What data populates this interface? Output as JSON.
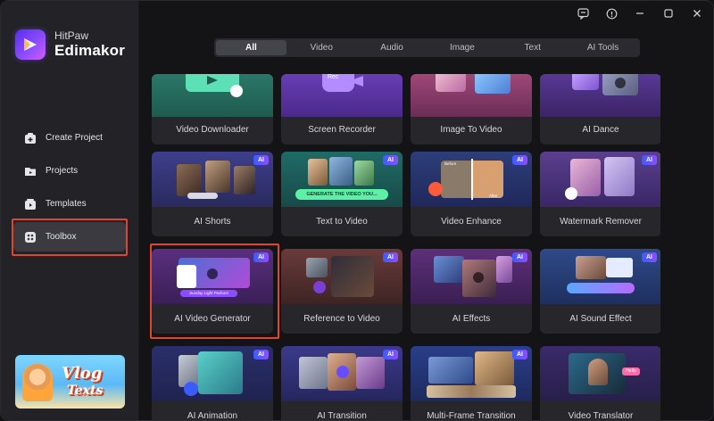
{
  "brand": {
    "line1": "HitPaw",
    "line2": "Edimakor"
  },
  "nav": [
    {
      "label": "Create Project",
      "icon": "create-project-icon"
    },
    {
      "label": "Projects",
      "icon": "projects-icon"
    },
    {
      "label": "Templates",
      "icon": "templates-icon"
    },
    {
      "label": "Toolbox",
      "icon": "toolbox-icon",
      "active": true
    }
  ],
  "promo": {
    "line1": "Vlog",
    "line2": "Texts"
  },
  "tabs": [
    "All",
    "Video",
    "Audio",
    "Image",
    "Text",
    "AI Tools"
  ],
  "active_tab": "All",
  "badge": "AI",
  "tools": [
    {
      "label": "Video Downloader",
      "ai": false
    },
    {
      "label": "Screen Recorder",
      "ai": false,
      "thumb_text": "Rec"
    },
    {
      "label": "Image To Video",
      "ai": false
    },
    {
      "label": "AI Dance",
      "ai": false
    },
    {
      "label": "AI Shorts",
      "ai": true
    },
    {
      "label": "Text to Video",
      "ai": true,
      "thumb_text": "GENERATE THE VIDEO YOU..."
    },
    {
      "label": "Video Enhance",
      "ai": true,
      "thumb_text_a": "Before",
      "thumb_text_b": "After"
    },
    {
      "label": "Watermark Remover",
      "ai": true
    },
    {
      "label": "AI Video Generator",
      "ai": true,
      "thumb_text": "Sunday Light Podcast",
      "selected": true
    },
    {
      "label": "Reference to Video",
      "ai": true
    },
    {
      "label": "AI Effects",
      "ai": true
    },
    {
      "label": "AI Sound Effect",
      "ai": true
    },
    {
      "label": "AI Animation",
      "ai": true
    },
    {
      "label": "AI Transition",
      "ai": true
    },
    {
      "label": "Multi-Frame Transition",
      "ai": true
    },
    {
      "label": "Video Translator",
      "ai": true,
      "thumb_text": "Hello"
    }
  ],
  "colors": {
    "accent_red": "#e0462e",
    "ai_badge_start": "#3a5cff",
    "ai_badge_end": "#8f4dff"
  }
}
